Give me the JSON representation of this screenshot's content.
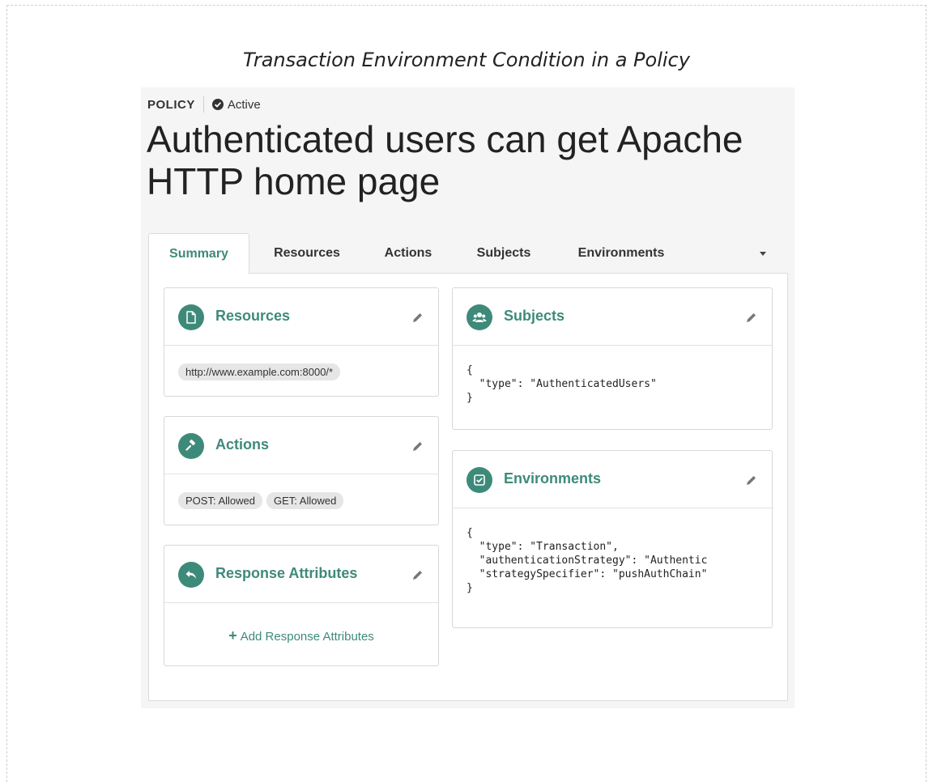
{
  "caption": "Transaction Environment Condition in a Policy",
  "header": {
    "label": "POLICY",
    "status": "Active",
    "title": "Authenticated users can get Apache HTTP home page"
  },
  "tabs": [
    {
      "label": "Summary",
      "active": true
    },
    {
      "label": "Resources",
      "active": false
    },
    {
      "label": "Actions",
      "active": false
    },
    {
      "label": "Subjects",
      "active": false
    },
    {
      "label": "Environments",
      "active": false
    }
  ],
  "cards": {
    "resources": {
      "title": "Resources",
      "chips": [
        "http://www.example.com:8000/*"
      ]
    },
    "actions": {
      "title": "Actions",
      "chips": [
        "POST: Allowed",
        "GET: Allowed"
      ]
    },
    "response_attributes": {
      "title": "Response Attributes",
      "add_label": "Add Response Attributes"
    },
    "subjects": {
      "title": "Subjects",
      "json": "{\n  \"type\": \"AuthenticatedUsers\"\n}"
    },
    "environments": {
      "title": "Environments",
      "json": "{\n  \"type\": \"Transaction\",\n  \"authenticationStrategy\": \"Authentic\n  \"strategySpecifier\": \"pushAuthChain\"\n}"
    }
  },
  "icons": {
    "status": "check-circle-icon",
    "resources": "document-icon",
    "actions": "gavel-icon",
    "response_attributes": "reply-icon",
    "subjects": "users-icon",
    "environments": "checkbox-icon",
    "edit": "pencil-icon",
    "tabs_more": "caret-down-icon"
  },
  "colors": {
    "accent": "#3e8a7a",
    "chip": "#e6e6e6",
    "panel": "#f5f5f5"
  }
}
